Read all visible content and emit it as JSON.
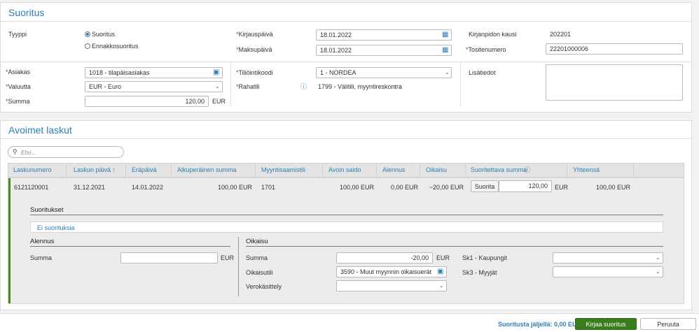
{
  "suoritus": {
    "title": "Suoritus",
    "tyyppi_label": "Tyyppi",
    "type_options": [
      "Suoritus",
      "Ennakkosuoritus"
    ],
    "kirjauspaiva_label": "Kirjauspäivä",
    "kirjauspaiva_value": "18.01.2022",
    "maksupaiva_label": "Maksupäivä",
    "maksupaiva_value": "18.01.2022",
    "kirjanpidon_kausi_label": "Kirjanpidon kausi",
    "kirjanpidon_kausi_value": "202201",
    "tositenumero_label": "Tositenumero",
    "tositenumero_value": "22201000006",
    "asiakas_label": "Asiakas",
    "asiakas_value": "1018 - tilapäisasiakas",
    "valuutta_label": "Valuutta",
    "valuutta_value": "EUR - Euro",
    "summa_label": "Summa",
    "summa_value": "120,00",
    "summa_unit": "EUR",
    "tiliointikoodi_label": "Tiliöintikoodi",
    "tiliointikoodi_value": "1 - NORDEA",
    "rahatili_label": "Rahatili",
    "rahatili_value": "1799 - Välitili, myyntireskontra",
    "lisatiedot_label": "Lisätiedot",
    "lisatiedot_value": ""
  },
  "avoimet": {
    "title": "Avoimet laskut",
    "search_placeholder": "Etsi...",
    "columns": [
      "Laskunumero",
      "Laskun päivä ↑",
      "Eräpäivä",
      "Alkuperäinen summa",
      "Myyntisaamistili",
      "Avoin saldo",
      "Alennus",
      "Oikaisu",
      "Suoritettava summa",
      "Yhteensä"
    ],
    "row": {
      "laskunumero": "6121120001",
      "laskun_paiva": "31.12.2021",
      "erapaiva": "14.01.2022",
      "alkuperainen": "100,00 EUR",
      "myyntisaamistili": "1701",
      "avoin_saldo": "100,00 EUR",
      "alennus": "0,00 EUR",
      "oikaisu": "−20,00 EUR",
      "suorita_button": "Suorita",
      "suoritettava_value": "120,00",
      "suoritettava_unit": "EUR",
      "yhteensa": "100,00 EUR"
    },
    "detail": {
      "suoritukset_title": "Suoritukset",
      "ei_suorituksia": "Ei suorituksia",
      "alennus_title": "Alennus",
      "alennus_summa_label": "Summa",
      "alennus_summa_value": "",
      "alennus_unit": "EUR",
      "oikaisu_title": "Oikaisu",
      "oikaisu_summa_label": "Summa",
      "oikaisu_summa_value": "-20,00",
      "oikaisu_unit": "EUR",
      "oikaisutili_label": "Oikaisutili",
      "oikaisutili_value": "3590 - Muut myynnin oikaisuerät",
      "verokasittely_label": "Verokäsittely",
      "verokasittely_value": "",
      "sk1_label": "Sk1 - Kaupungit",
      "sk1_value": "",
      "sk3_label": "Sk3 - Myyjät",
      "sk3_value": ""
    }
  },
  "footer": {
    "remaining_text": "Suoritusta jäljellä: 0,00 EUR",
    "kirjaa_button": "Kirjaa suoritus",
    "peruuta_button": "Peruuta"
  },
  "colors": {
    "accent": "#2e7fb5",
    "primary_button": "#3a7d1c",
    "row_marker": "#4a8a1f"
  }
}
